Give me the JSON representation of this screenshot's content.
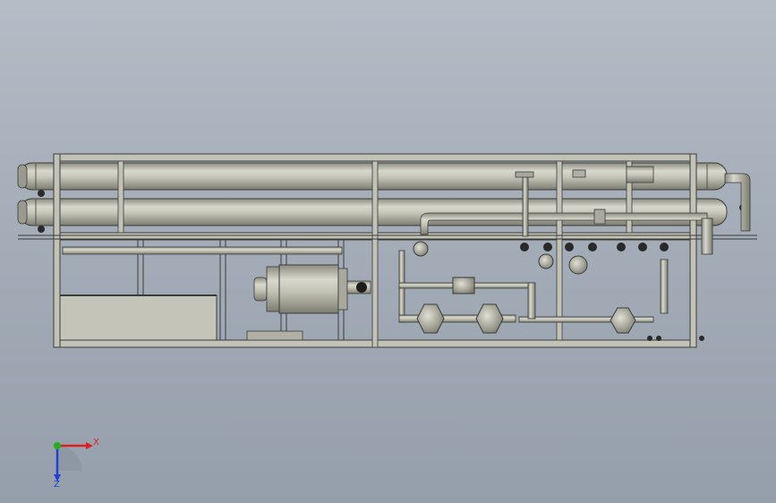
{
  "viewport": {
    "background_top": "#b4bcc6",
    "background_bottom": "#959fab"
  },
  "model": {
    "line_color": "#3a3c3a",
    "pipe_fill": "#b9b9ac",
    "frame_fill": "#c2c2b6",
    "panel_fill": "#c4c4b8"
  },
  "triad": {
    "x_label": "X",
    "z_label": "Z",
    "x_color": "#e02020",
    "y_color": "#20b020",
    "z_color": "#2040d0"
  }
}
